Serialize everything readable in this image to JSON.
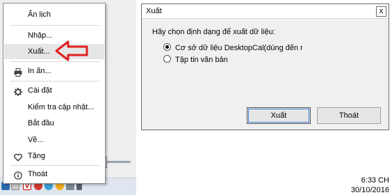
{
  "menu": {
    "items": [
      {
        "label": "Ẩn lịch"
      },
      {
        "label": "Nhập..."
      },
      {
        "label": "Xuất..."
      },
      {
        "label": "In ấn..."
      },
      {
        "label": "Cài đặt"
      },
      {
        "label": "Kiểm tra cập nhật..."
      },
      {
        "label": "Bắt đầu"
      },
      {
        "label": "Về..."
      },
      {
        "label": "Tặng"
      },
      {
        "label": "Thoát"
      }
    ],
    "icons": [
      "printer-icon",
      "gear-icon",
      "heart-icon",
      "info-icon"
    ]
  },
  "dialog": {
    "title": "Xuất",
    "close_label": "x",
    "prompt": "Hãy chọn định dạng để xuất dữ liệu:",
    "options": [
      {
        "label": "Cơ sở dữ liệu DesktopCal(dùng đến nhập khẩu)",
        "checked": true
      },
      {
        "label": "Tập tin văn bản",
        "checked": false
      }
    ],
    "export_button": "Xuất",
    "exit_button": "Thoát"
  },
  "taskbar": {
    "time": "6:33 CH",
    "date": "30/10/2016"
  },
  "colors": {
    "arrow": "#e02020",
    "menu_hover": "#e6e6e6",
    "dialog_bg": "#f0f0f0"
  }
}
